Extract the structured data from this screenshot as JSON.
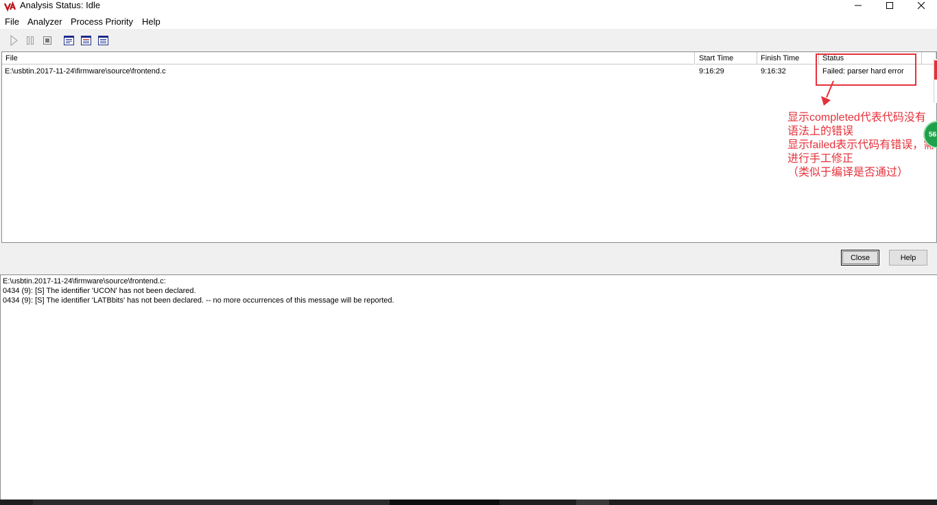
{
  "window": {
    "title": "Analysis Status: Idle",
    "icons": {
      "app": "qac-logo-icon",
      "minimize": "minimize-icon",
      "maximize": "maximize-icon",
      "close": "close-icon"
    }
  },
  "menu": {
    "items": [
      {
        "label": "File"
      },
      {
        "label": "Analyzer"
      },
      {
        "label": "Process Priority"
      },
      {
        "label": "Help"
      }
    ]
  },
  "toolbar": {
    "buttons": [
      "play-icon",
      "pause-icon",
      "stop-icon",
      "report-icon",
      "report-red-icon",
      "report-blue-icon"
    ]
  },
  "results": {
    "columns": [
      "File",
      "Start Time",
      "Finish Time",
      "Status"
    ],
    "rows": [
      {
        "file": "E:\\usbtin.2017-11-24\\firmware\\source\\frontend.c",
        "start": "9:16:29",
        "finish": "9:16:32",
        "status": "Failed: parser hard error"
      }
    ]
  },
  "annotation": {
    "lines": [
      "显示completed代表代码没有",
      "语法上的错误",
      "显示failed表示代码有错误，需",
      "进行手工修正",
      "（类似于编译是否通过）"
    ],
    "color": "#e5303a"
  },
  "float_badge": {
    "text": "56"
  },
  "buttons": {
    "close": "Close",
    "help": "Help"
  },
  "messages": {
    "lines": [
      "E:\\usbtin.2017-11-24\\firmware\\source\\frontend.c:",
      "0434 (9): [S] The identifier 'UCON' has not been declared.",
      "0434 (9): [S] The identifier 'LATBbits' has not been declared. -- no more occurrences of this message will be reported."
    ]
  }
}
